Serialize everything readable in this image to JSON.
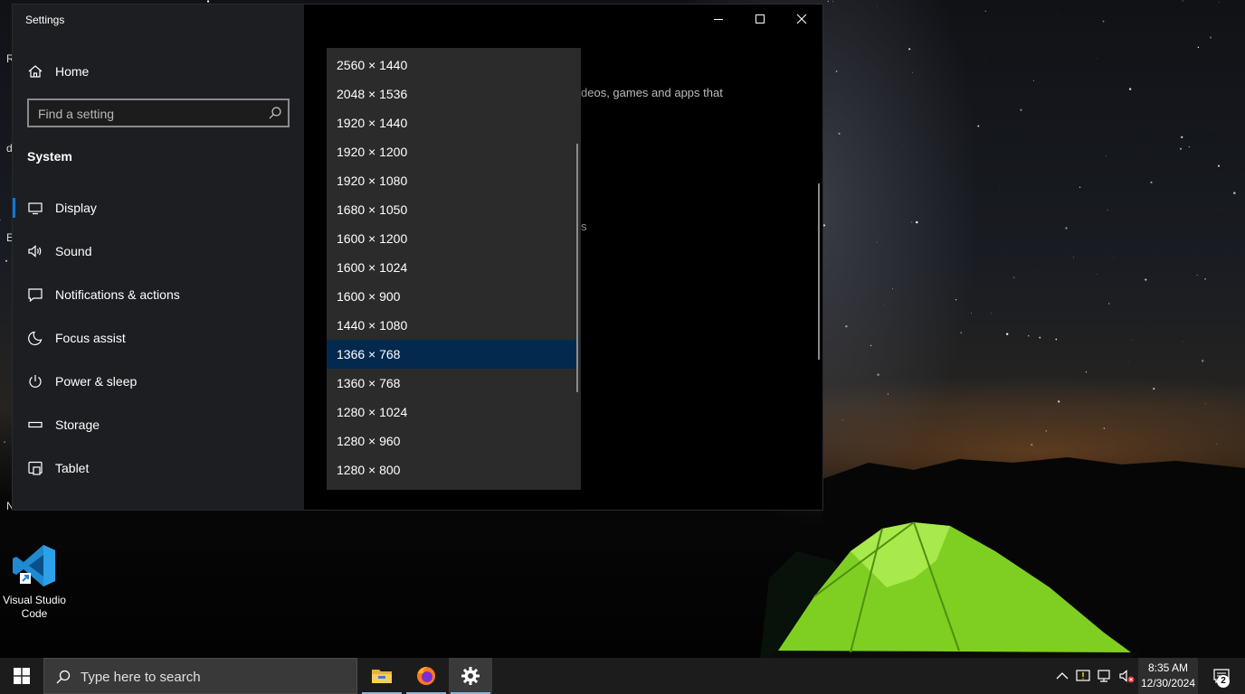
{
  "desktop": {
    "shortcut_label": "Visual Studio\nCode",
    "edge_letters": [
      "R",
      "d",
      "E",
      "N"
    ]
  },
  "settings": {
    "window_title": "Settings",
    "home_label": "Home",
    "search_placeholder": "Find a setting",
    "section_heading": "System",
    "nav_items": [
      {
        "label": "Display",
        "icon": "monitor-icon",
        "selected": true
      },
      {
        "label": "Sound",
        "icon": "speaker-icon"
      },
      {
        "label": "Notifications & actions",
        "icon": "notification-icon"
      },
      {
        "label": "Focus assist",
        "icon": "moon-icon"
      },
      {
        "label": "Power & sleep",
        "icon": "power-icon"
      },
      {
        "label": "Storage",
        "icon": "storage-icon"
      },
      {
        "label": "Tablet",
        "icon": "tablet-icon"
      }
    ],
    "content_partial_text": "deos, games and apps that",
    "content_partial_text2": "s"
  },
  "resolution_dropdown": {
    "options": [
      "2560 × 1440",
      "2048 × 1536",
      "1920 × 1440",
      "1920 × 1200",
      "1920 × 1080",
      "1680 × 1050",
      "1600 × 1200",
      "1600 × 1024",
      "1600 × 900",
      "1440 × 1080",
      "1366 × 768",
      "1360 × 768",
      "1280 × 1024",
      "1280 × 960",
      "1280 × 800"
    ],
    "selected_index": 10
  },
  "taskbar": {
    "search_placeholder": "Type here to search",
    "time": "8:35 AM",
    "date": "12/30/2024",
    "notification_count": "2",
    "apps": [
      "file-explorer-icon",
      "firefox-icon",
      "settings-gear-icon"
    ]
  },
  "colors": {
    "accent": "#0a7ad6",
    "selected_option": "#03294f",
    "taskbar": "#1c1c1c"
  }
}
